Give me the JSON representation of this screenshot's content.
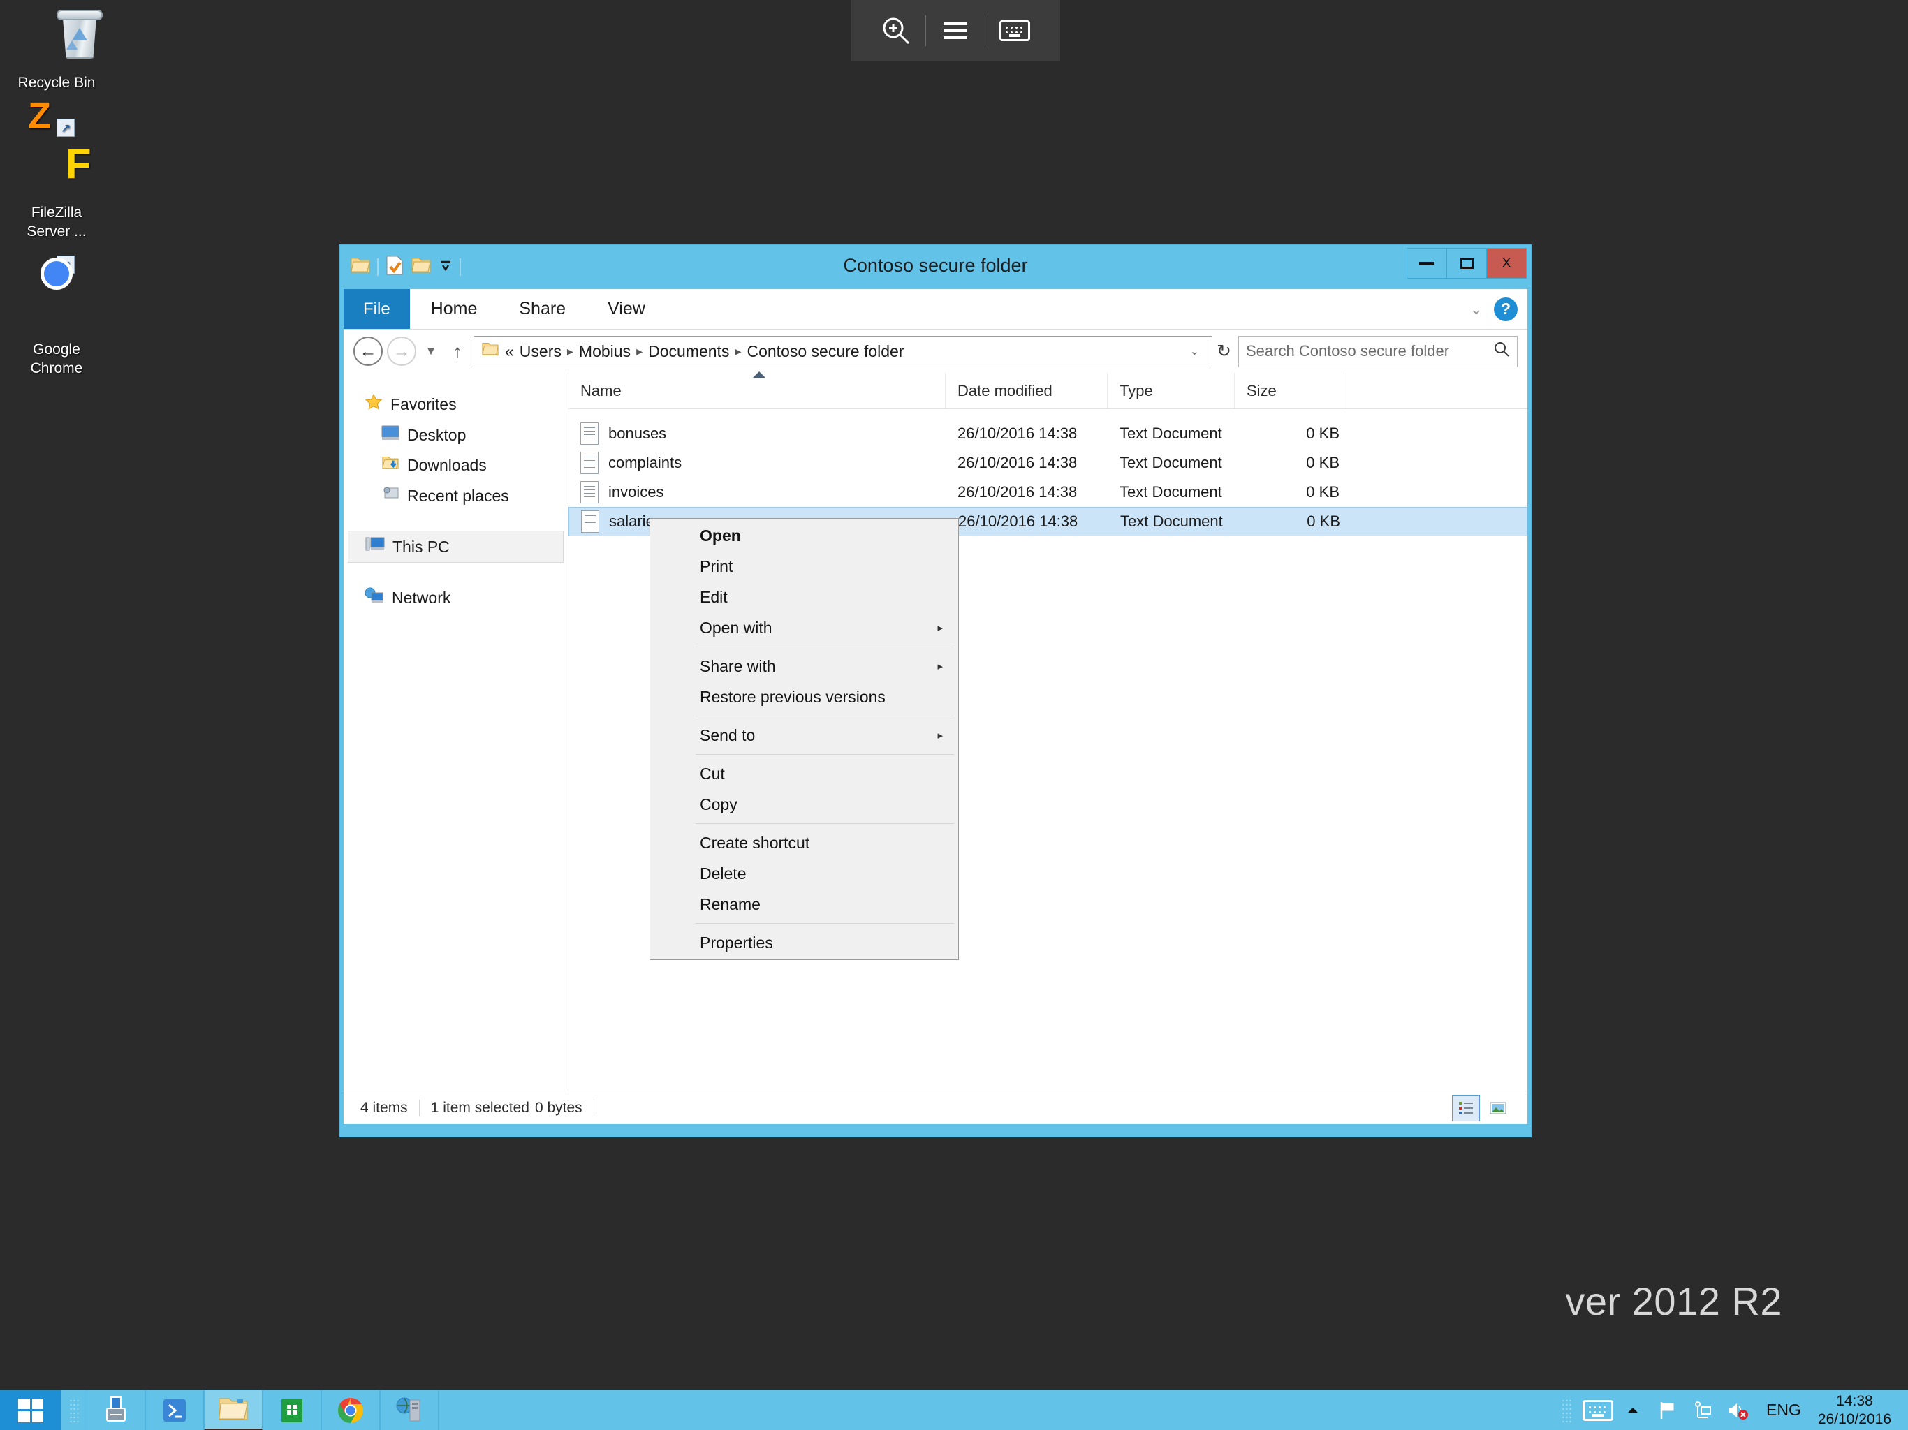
{
  "desktop": {
    "watermark": "ver 2012 R2",
    "icons": [
      {
        "label": "Recycle Bin",
        "icon": "recycle-bin-icon"
      },
      {
        "label": "FileZilla\nServer ...",
        "label_line1": "FileZilla",
        "label_line2": "Server ...",
        "icon": "filezilla-server-icon"
      },
      {
        "label": "Google\nChrome",
        "label_line1": "Google",
        "label_line2": "Chrome",
        "icon": "google-chrome-icon"
      }
    ]
  },
  "float_toolbar": {
    "zoom_icon": "zoom-in-icon",
    "menu_icon": "hamburger-menu-icon",
    "keyboard_icon": "keyboard-icon"
  },
  "explorer": {
    "title": "Contoso secure folder",
    "quick_access": {
      "folder_icon": "folder-icon",
      "properties_icon": "properties-icon",
      "new_folder_icon": "new-folder-icon",
      "dropdown_icon": "chevron-down-icon"
    },
    "window_controls": {
      "minimize": "minimize-icon",
      "maximize": "maximize-icon",
      "close": "X"
    },
    "tabs": [
      {
        "label": "File",
        "active": true
      },
      {
        "label": "Home",
        "active": false
      },
      {
        "label": "Share",
        "active": false
      },
      {
        "label": "View",
        "active": false
      }
    ],
    "ribbon_right": {
      "collapse": "⌄",
      "help": "?"
    },
    "address": {
      "back_icon": "←",
      "forward_icon": "→",
      "history_icon": "▼",
      "up_icon": "↑",
      "folder_icon": "folder-icon",
      "prefix": "«",
      "crumbs": [
        "Users",
        "Mobius",
        "Documents",
        "Contoso secure folder"
      ],
      "separator": "▸",
      "dropdown_icon": "⌄",
      "refresh_icon": "↻"
    },
    "search": {
      "placeholder": "Search Contoso secure folder",
      "icon": "search-icon"
    },
    "navpane": {
      "favorites": {
        "label": "Favorites",
        "icon": "star-icon"
      },
      "favorites_children": [
        {
          "label": "Desktop",
          "icon": "desktop-icon"
        },
        {
          "label": "Downloads",
          "icon": "downloads-icon"
        },
        {
          "label": "Recent places",
          "icon": "recent-places-icon"
        }
      ],
      "this_pc": {
        "label": "This PC",
        "icon": "computer-icon",
        "selected": true
      },
      "network": {
        "label": "Network",
        "icon": "network-icon"
      }
    },
    "columns": [
      {
        "label": "Name",
        "sorted": "asc"
      },
      {
        "label": "Date modified"
      },
      {
        "label": "Type"
      },
      {
        "label": "Size"
      }
    ],
    "files": [
      {
        "name": "bonuses",
        "date": "26/10/2016 14:38",
        "type": "Text Document",
        "size": "0 KB",
        "selected": false
      },
      {
        "name": "complaints",
        "date": "26/10/2016 14:38",
        "type": "Text Document",
        "size": "0 KB",
        "selected": false
      },
      {
        "name": "invoices",
        "date": "26/10/2016 14:38",
        "type": "Text Document",
        "size": "0 KB",
        "selected": false
      },
      {
        "name": "salaries",
        "date": "26/10/2016 14:38",
        "type": "Text Document",
        "size": "0 KB",
        "selected": true
      }
    ],
    "status": {
      "item_count": "4 items",
      "selection": "1 item selected",
      "selection_size": "0 bytes",
      "view_details_icon": "details-view-icon",
      "view_large_icon": "large-icons-view-icon"
    }
  },
  "context_menu": {
    "items": [
      {
        "label": "Open",
        "bold": true
      },
      {
        "label": "Print"
      },
      {
        "label": "Edit"
      },
      {
        "label": "Open with",
        "submenu": true
      },
      {
        "separator": true
      },
      {
        "label": "Share with",
        "submenu": true
      },
      {
        "label": "Restore previous versions"
      },
      {
        "separator": true
      },
      {
        "label": "Send to",
        "submenu": true
      },
      {
        "separator": true
      },
      {
        "label": "Cut"
      },
      {
        "label": "Copy"
      },
      {
        "separator": true
      },
      {
        "label": "Create shortcut"
      },
      {
        "label": "Delete"
      },
      {
        "label": "Rename"
      },
      {
        "separator": true
      },
      {
        "label": "Properties"
      }
    ],
    "submenu_arrow": "▸"
  },
  "taskbar": {
    "start_icon": "windows-start-icon",
    "items": [
      {
        "name": "server-manager",
        "running": true
      },
      {
        "name": "powershell",
        "running": true
      },
      {
        "name": "file-explorer",
        "running": true,
        "active": true
      },
      {
        "name": "windows-store",
        "running": true
      },
      {
        "name": "google-chrome",
        "running": true
      },
      {
        "name": "iis-manager",
        "running": true
      }
    ],
    "tray": {
      "keyboard_icon": "keyboard-icon",
      "expand_icon": "show-hidden-icons-icon",
      "action_center_icon": "action-center-flag-icon",
      "network_icon": "network-icon",
      "volume_icon": "volume-muted-icon",
      "language": "ENG",
      "time": "14:38",
      "date": "26/10/2016"
    }
  },
  "colors": {
    "accent": "#63c2e8",
    "file_tab": "#1a7fc1",
    "close_button": "#c75b52",
    "selection": "#cce4f7",
    "desktop": "#2b2b2b"
  }
}
